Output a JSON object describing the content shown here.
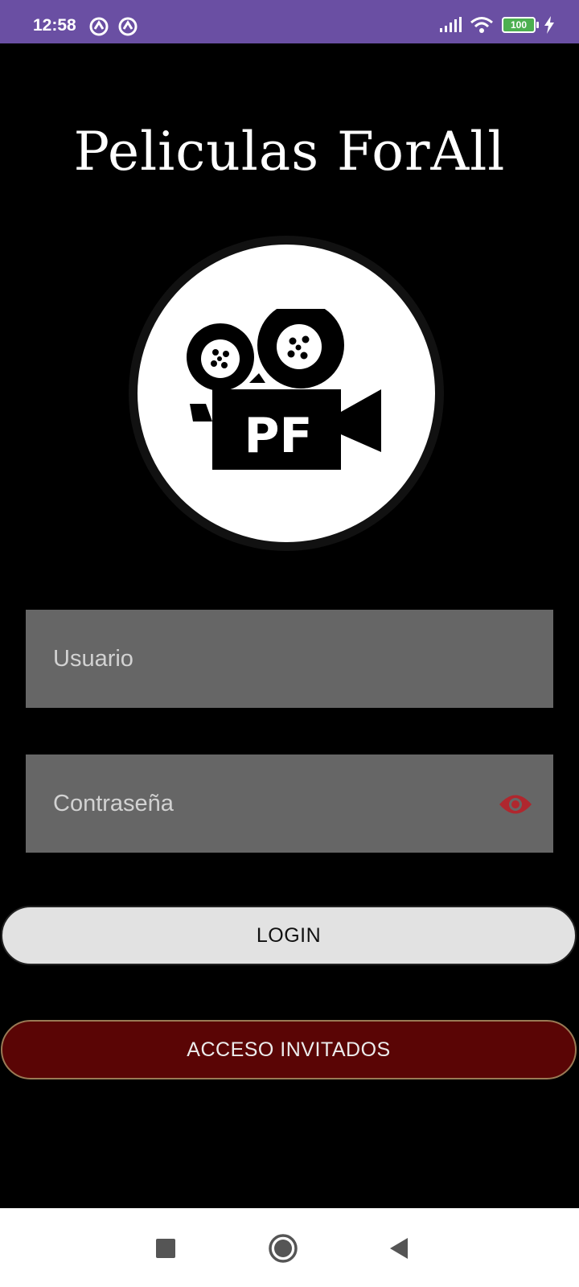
{
  "status_bar": {
    "time": "12:58",
    "left_icons": [
      "sync-badge-icon",
      "sync-badge-icon"
    ],
    "right_icons": [
      "signal-icon",
      "wifi-icon",
      "battery-icon",
      "charging-icon"
    ],
    "battery_level": "100"
  },
  "app": {
    "title": "Peliculas ForAll",
    "logo_text": "PF"
  },
  "form": {
    "username_placeholder": "Usuario",
    "username_value": "",
    "password_placeholder": "Contraseña",
    "password_value": "",
    "eye_icon": "eye-icon"
  },
  "buttons": {
    "login": "LOGIN",
    "guest": "ACCESO INVITADOS"
  },
  "nav": {
    "items": [
      "recents-icon",
      "home-icon",
      "back-icon"
    ]
  },
  "colors": {
    "status_bar": "#6a4fa3",
    "background": "#000000",
    "field": "#666666",
    "eye": "#b0272e",
    "login_button": "#e2e2e2",
    "guest_button": "#5a0505"
  }
}
